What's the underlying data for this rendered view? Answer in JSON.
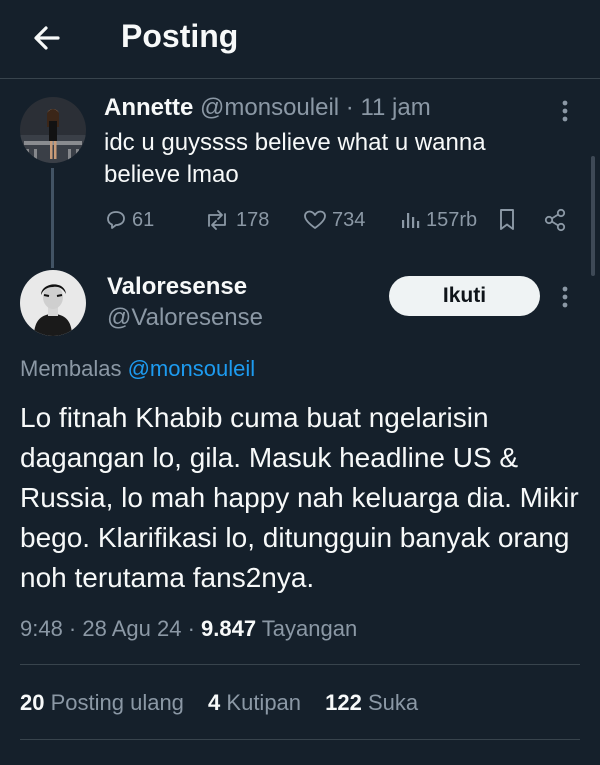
{
  "header": {
    "title": "Posting"
  },
  "parent_post": {
    "author_name": "Annette",
    "handle": "@monsouleil",
    "time": "· 11 jam",
    "text": "idc u guyssss believe what u wanna believe lmao",
    "actions": {
      "replies": "61",
      "reposts": "178",
      "likes": "734",
      "views": "157rb"
    }
  },
  "main_post": {
    "author_name": "Valoresense",
    "handle": "@Valoresense",
    "follow_label": "Ikuti",
    "reply_prefix": "Membalas ",
    "reply_to": "@monsouleil",
    "text": "Lo fitnah Khabib cuma buat ngelarisin dagangan lo, gila. Masuk headline US & Russia, lo mah happy nah keluarga dia. Mikir bego. Klarifikasi lo, ditungguin banyak orang noh terutama fans2nya.",
    "timestamp": "9:48 · 28 Agu 24 · ",
    "views_count": "9.847",
    "views_label": " Tayangan",
    "stats": {
      "reposts_count": "20",
      "reposts_label": " Posting ulang",
      "quotes_count": "4",
      "quotes_label": " Kutipan",
      "likes_count": "122",
      "likes_label": " Suka"
    }
  },
  "colors": {
    "background": "#15202b",
    "text": "#f7f9f9",
    "muted": "#8b98a5",
    "link": "#1d9bf0",
    "border": "#38444d"
  }
}
